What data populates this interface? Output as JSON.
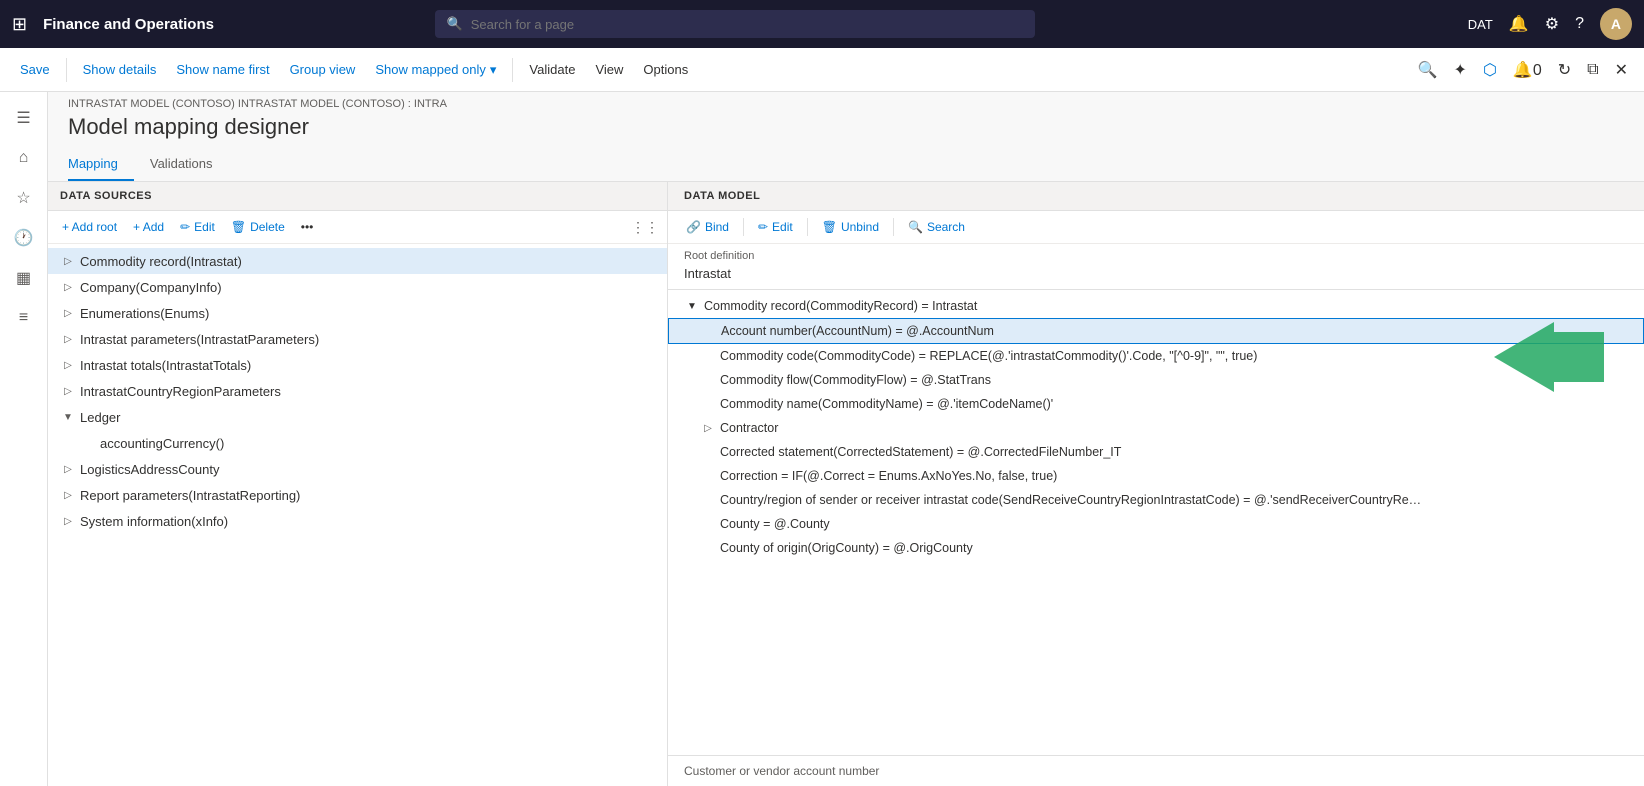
{
  "app": {
    "title": "Finance and Operations",
    "env": "DAT"
  },
  "search": {
    "placeholder": "Search for a page"
  },
  "toolbar": {
    "save": "Save",
    "show_details": "Show details",
    "show_name_first": "Show name first",
    "group_view": "Group view",
    "show_mapped_only": "Show mapped only",
    "validate": "Validate",
    "view": "View",
    "options": "Options"
  },
  "breadcrumb": {
    "path": "INTRASTAT MODEL (CONTOSO) INTRASTAT MODEL (CONTOSO) : INTRA"
  },
  "page_title": "Model mapping designer",
  "tabs": [
    {
      "label": "Mapping",
      "active": true
    },
    {
      "label": "Validations",
      "active": false
    }
  ],
  "left_panel": {
    "header": "DATA SOURCES",
    "add_root": "+ Add root",
    "add": "+ Add",
    "edit": "Edit",
    "delete": "Delete",
    "items": [
      {
        "label": "Commodity record(Intrastat)",
        "expanded": false,
        "indent": 0,
        "selected": true
      },
      {
        "label": "Company(CompanyInfo)",
        "expanded": false,
        "indent": 0,
        "selected": false
      },
      {
        "label": "Enumerations(Enums)",
        "expanded": false,
        "indent": 0,
        "selected": false
      },
      {
        "label": "Intrastat parameters(IntrastatParameters)",
        "expanded": false,
        "indent": 0,
        "selected": false
      },
      {
        "label": "Intrastat totals(IntrastatTotals)",
        "expanded": false,
        "indent": 0,
        "selected": false
      },
      {
        "label": "IntrastatCountryRegionParameters",
        "expanded": false,
        "indent": 0,
        "selected": false
      },
      {
        "label": "Ledger",
        "expanded": true,
        "indent": 0,
        "selected": false
      },
      {
        "label": "accountingCurrency()",
        "expanded": false,
        "indent": 1,
        "selected": false
      },
      {
        "label": "LogisticsAddressCounty",
        "expanded": false,
        "indent": 0,
        "selected": false
      },
      {
        "label": "Report parameters(IntrastatReporting)",
        "expanded": false,
        "indent": 0,
        "selected": false
      },
      {
        "label": "System information(xInfo)",
        "expanded": false,
        "indent": 0,
        "selected": false
      }
    ]
  },
  "right_panel": {
    "header": "DATA MODEL",
    "bind": "Bind",
    "edit": "Edit",
    "unbind": "Unbind",
    "search": "Search",
    "root_def_label": "Root definition",
    "root_def_value": "Intrastat",
    "items": [
      {
        "label": "Commodity record(CommodityRecord) = Intrastat",
        "indent": 0,
        "expanded": true,
        "selected": false
      },
      {
        "label": "Account number(AccountNum) = @.AccountNum",
        "indent": 1,
        "expanded": false,
        "selected": true
      },
      {
        "label": "Commodity code(CommodityCode) = REPLACE(@.'intrastatCommodity()'.Code, \"[^0-9]\", \"\", true)",
        "indent": 1,
        "expanded": false,
        "selected": false
      },
      {
        "label": "Commodity flow(CommodityFlow) = @.StatTrans",
        "indent": 1,
        "expanded": false,
        "selected": false
      },
      {
        "label": "Commodity name(CommodityName) = @.'itemCodeName()'",
        "indent": 1,
        "expanded": false,
        "selected": false
      },
      {
        "label": "Contractor",
        "indent": 1,
        "expanded": false,
        "selected": false
      },
      {
        "label": "Corrected statement(CorrectedStatement) = @.CorrectedFileNumber_IT",
        "indent": 1,
        "expanded": false,
        "selected": false
      },
      {
        "label": "Correction = IF(@.Correct = Enums.AxNoYes.No, false, true)",
        "indent": 1,
        "expanded": false,
        "selected": false
      },
      {
        "label": "Country/region of sender or receiver intrastat code(SendReceiveCountryRegionIntrastatCode) = @.'sendReceiverCountryRe…",
        "indent": 1,
        "expanded": false,
        "selected": false
      },
      {
        "label": "County = @.County",
        "indent": 1,
        "expanded": false,
        "selected": false
      },
      {
        "label": "County of origin(OrigCounty) = @.OrigCounty",
        "indent": 1,
        "expanded": false,
        "selected": false
      }
    ],
    "bottom_text": "Customer or vendor account number"
  },
  "sidebar_icons": [
    "waffle",
    "home",
    "star",
    "history",
    "table",
    "list"
  ]
}
